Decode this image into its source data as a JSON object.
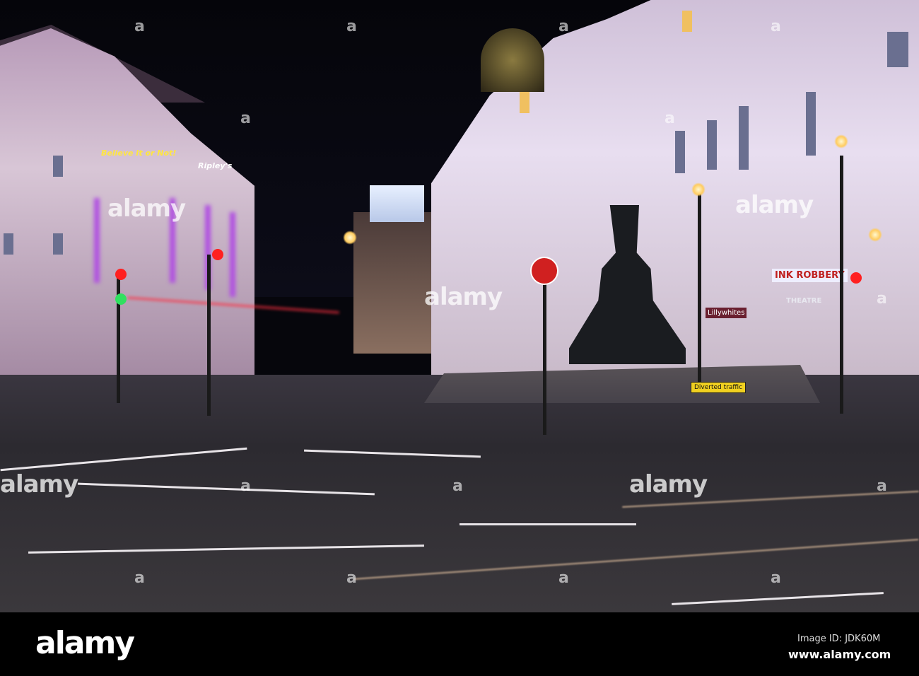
{
  "scene": {
    "signs": {
      "believe_it": "Believe It or Not!",
      "ripleys": "Ripley's",
      "theatre": "THEATRE",
      "show_banner": "INK ROBBERY",
      "store": "Lillywhites",
      "road_sign": "Diverted traffic"
    },
    "colors": {
      "sky": "#05050a",
      "facade_purple": "#b050e0",
      "road": "#2c2a30",
      "traffic_red": "#ff2020",
      "traffic_green": "#30e060"
    }
  },
  "watermark": {
    "text": "alamy",
    "letter": "a"
  },
  "footer": {
    "logo": "alamy",
    "image_id": "Image ID: JDK60M",
    "url": "www.alamy.com"
  }
}
